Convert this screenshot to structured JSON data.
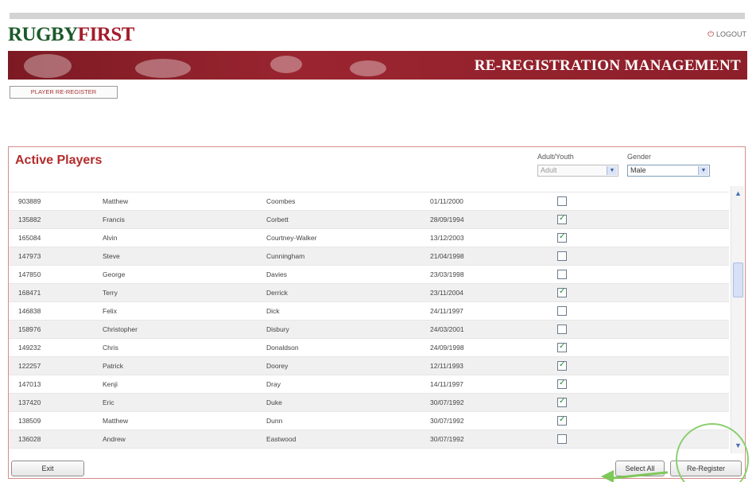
{
  "app": {
    "logo_part1": "RUGBY",
    "logo_part2": "FIRST",
    "logout_label": "LOGOUT",
    "logout_icon": "power-icon",
    "banner_title": "RE-REGISTRATION MANAGEMENT"
  },
  "nav": {
    "player_reregister_label": "PLAYER RE-REGISTER"
  },
  "panel": {
    "title": "Active Players",
    "filters": {
      "adult_youth_label": "Adult/Youth",
      "adult_youth_value": "Adult",
      "gender_label": "Gender",
      "gender_value": "Male"
    }
  },
  "rows": [
    {
      "id": "903889",
      "first": "Matthew",
      "last": "Coombes",
      "dob": "01/11/2000",
      "checked": false
    },
    {
      "id": "135882",
      "first": "Francis",
      "last": "Corbett",
      "dob": "28/09/1994",
      "checked": true
    },
    {
      "id": "165084",
      "first": "Alvin",
      "last": "Courtney-Walker",
      "dob": "13/12/2003",
      "checked": true
    },
    {
      "id": "147973",
      "first": "Steve",
      "last": "Cunningham",
      "dob": "21/04/1998",
      "checked": false
    },
    {
      "id": "147850",
      "first": "George",
      "last": "Davies",
      "dob": "23/03/1998",
      "checked": false
    },
    {
      "id": "168471",
      "first": "Terry",
      "last": "Derrick",
      "dob": "23/11/2004",
      "checked": true
    },
    {
      "id": "146838",
      "first": "Felix",
      "last": "Dick",
      "dob": "24/11/1997",
      "checked": false
    },
    {
      "id": "158976",
      "first": "Christopher",
      "last": "Disbury",
      "dob": "24/03/2001",
      "checked": false
    },
    {
      "id": "149232",
      "first": "Chris",
      "last": "Donaldson",
      "dob": "24/09/1998",
      "checked": true
    },
    {
      "id": "122257",
      "first": "Patrick",
      "last": "Doorey",
      "dob": "12/11/1993",
      "checked": true
    },
    {
      "id": "147013",
      "first": "Kenji",
      "last": "Dray",
      "dob": "14/11/1997",
      "checked": true
    },
    {
      "id": "137420",
      "first": "Eric",
      "last": "Duke",
      "dob": "30/07/1992",
      "checked": true
    },
    {
      "id": "138509",
      "first": "Matthew",
      "last": "Dunn",
      "dob": "30/07/1992",
      "checked": true
    },
    {
      "id": "136028",
      "first": "Andrew",
      "last": "Eastwood",
      "dob": "30/07/1992",
      "checked": false
    }
  ],
  "buttons": {
    "exit": "Exit",
    "select_all": "Select All",
    "re_register": "Re-Register"
  },
  "colors": {
    "brand_green": "#1b5a2a",
    "brand_red": "#a31d2b",
    "banner_bg": "#8d1f2a",
    "annotation_green": "#8ccf6e"
  }
}
